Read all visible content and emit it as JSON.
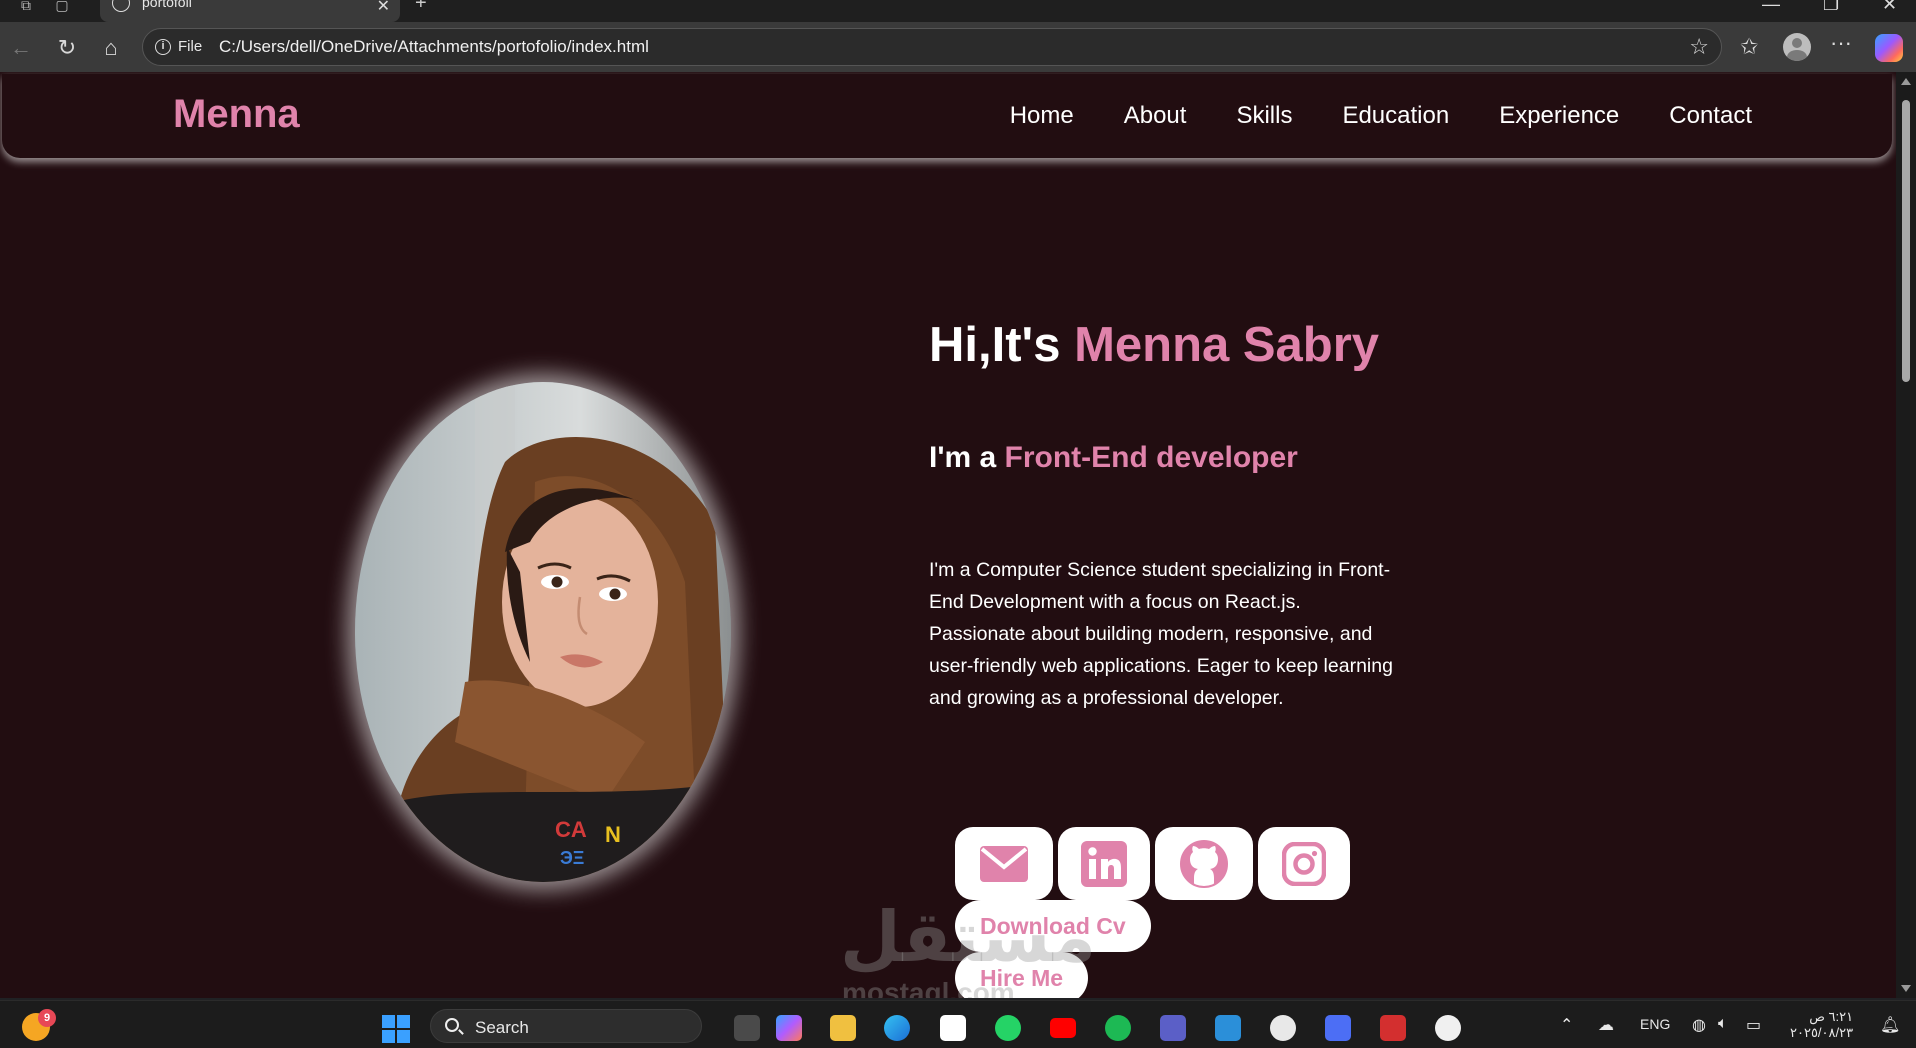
{
  "browser": {
    "tab_title": "portofoli",
    "tab_close": "✕",
    "new_tab": "+",
    "file_chip": "File",
    "url": "C:/Users/dell/OneDrive/Attachments/portofolio/index.html",
    "icons": [
      "back-icon",
      "reload-icon",
      "home-icon",
      "info-icon",
      "star-icon",
      "favorites-icon",
      "profile-icon",
      "more-icon",
      "copilot-icon"
    ]
  },
  "site": {
    "logo": "Menna",
    "nav": [
      "Home",
      "About",
      "Skills",
      "Education",
      "Experience",
      "Contact"
    ],
    "hero": {
      "greeting": "Hi,It's ",
      "name": "Menna Sabry",
      "role_prefix": "I'm a ",
      "role": "Front-End developer",
      "bio": "I'm a Computer Science student specializing in Front-End Development with a focus on React.js. Passionate about building modern, responsive, and user-friendly web applications. Eager to keep learning and growing as a professional developer."
    },
    "socials": [
      "envelope-icon",
      "linkedin-icon",
      "github-icon",
      "instagram-icon"
    ],
    "buttons": {
      "download_cv": "Download Cv",
      "hire_me": "Hire Me"
    },
    "colors": {
      "background": "#220d11",
      "accent": "#e083ab",
      "text": "#ffffff"
    }
  },
  "watermark": {
    "arabic": "مستقل",
    "latin": "mostaql.com"
  },
  "taskbar": {
    "notification_count": "9",
    "search_label": "Search",
    "language": "ENG",
    "clock_time": "٦:٢١ ص",
    "clock_date": "٢٠٢٥/٠٨/٢٣"
  }
}
